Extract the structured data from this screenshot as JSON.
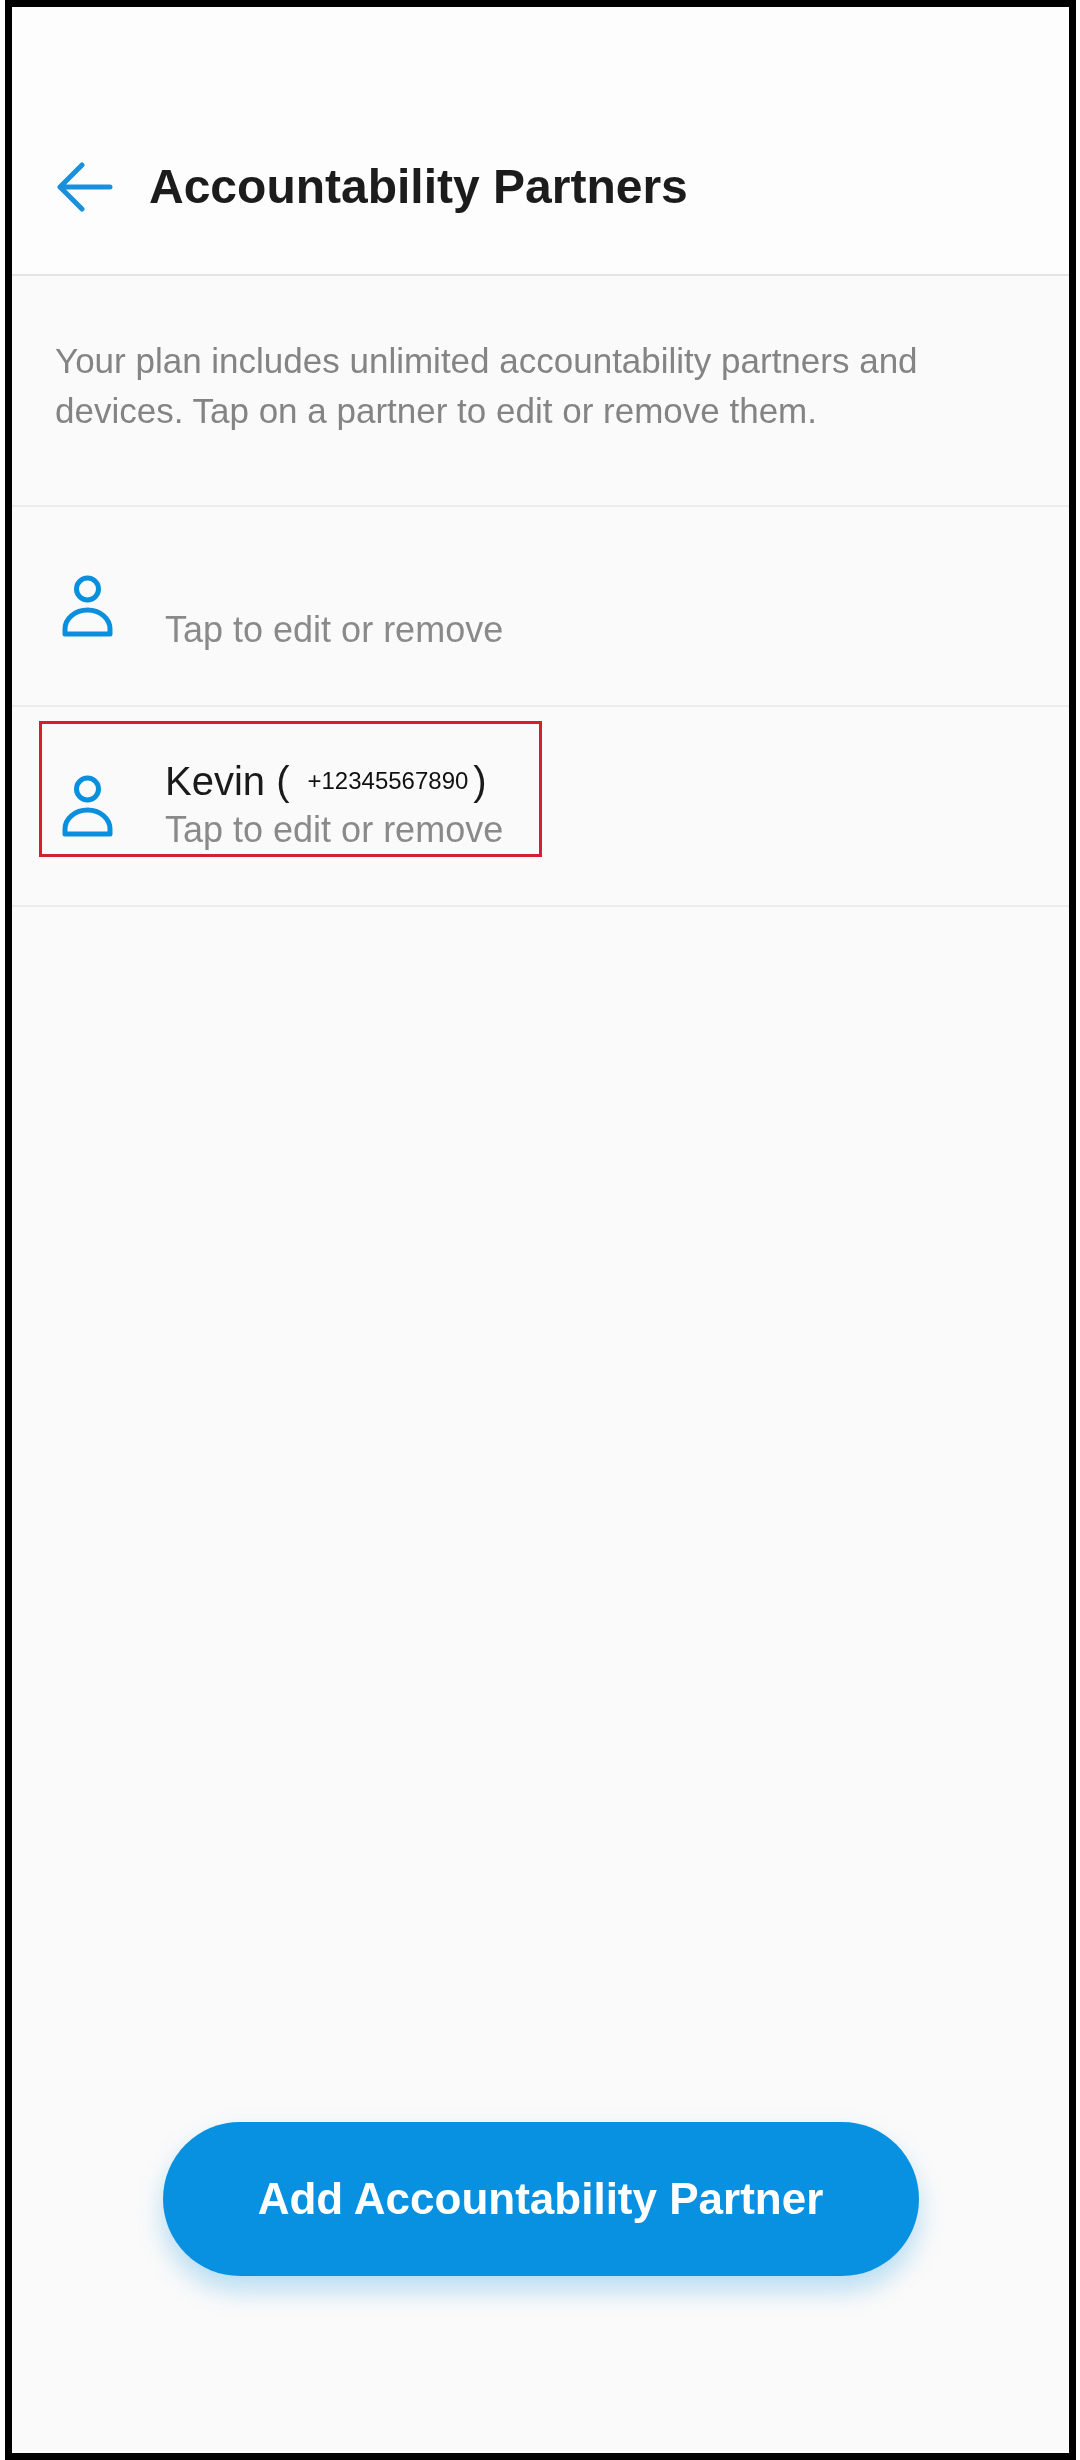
{
  "header": {
    "title": "Accountability Partners"
  },
  "description": "Your plan includes unlimited accountability partners and devices. Tap on a partner to edit or remove them.",
  "partners": [
    {
      "subtitle": "Tap to edit or remove",
      "highlighted": false
    },
    {
      "name": "Kevin (",
      "phone": "+12345567890",
      "name_end": ")",
      "subtitle": "Tap to edit or remove",
      "highlighted": true
    }
  ],
  "add_button": {
    "label": "Add Accountability Partner"
  }
}
